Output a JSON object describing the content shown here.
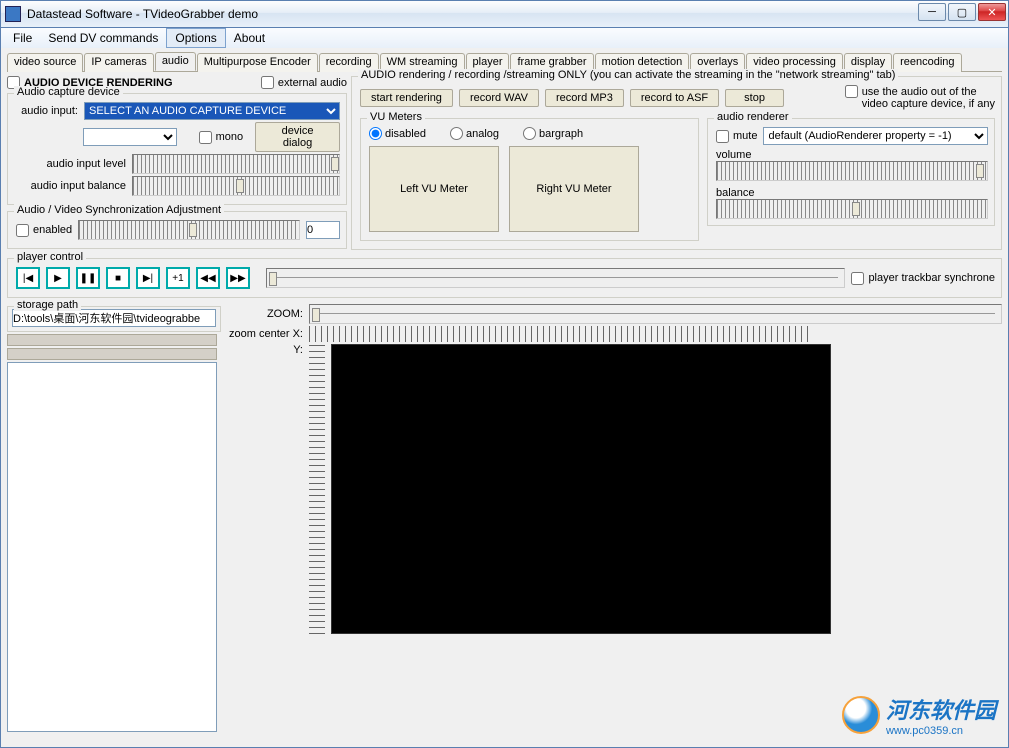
{
  "window": {
    "title": "Datastead Software - TVideoGrabber demo"
  },
  "menu": {
    "file": "File",
    "senddv": "Send DV commands",
    "options": "Options",
    "about": "About"
  },
  "tabs": [
    "video source",
    "IP cameras",
    "audio",
    "Multipurpose Encoder",
    "recording",
    "WM streaming",
    "player",
    "frame grabber",
    "motion detection",
    "overlays",
    "video processing",
    "display",
    "reencoding"
  ],
  "tabs_active_index": 2,
  "audio_render_cb": "AUDIO DEVICE RENDERING",
  "ext_audio": "external audio",
  "capture": {
    "legend": "Audio capture device",
    "audio_input_lbl": "audio input:",
    "select_text": "SELECT AN AUDIO CAPTURE DEVICE",
    "mono": "mono",
    "device_dialog": "device dialog",
    "level": "audio input level",
    "balance": "audio input balance"
  },
  "sync": {
    "legend": "Audio / Video Synchronization Adjustment",
    "enabled": "enabled",
    "value": "0"
  },
  "audiorec": {
    "legend": "AUDIO rendering / recording /streaming ONLY  (you can activate the streaming in the \"network streaming\" tab)",
    "start": "start rendering",
    "wav": "record WAV",
    "mp3": "record MP3",
    "asf": "record to ASF",
    "stop": "stop",
    "useout1": "use the audio out of the",
    "useout2": "video capture device, if any"
  },
  "vu": {
    "legend": "VU Meters",
    "disabled": "disabled",
    "analog": "analog",
    "bargraph": "bargraph",
    "left": "Left VU Meter",
    "right": "Right VU Meter"
  },
  "renderer": {
    "legend": "audio renderer",
    "mute": "mute",
    "default": "default (AudioRenderer property = -1)",
    "volume": "volume",
    "balance": "balance"
  },
  "player": {
    "legend": "player control",
    "sync": "player trackbar synchrone"
  },
  "storage": {
    "legend": "storage path",
    "path": "D:\\tools\\桌面\\河东软件园\\tvideograbbe"
  },
  "zoom": {
    "label": "ZOOM:",
    "cx": "zoom center X:",
    "cy": "Y:"
  },
  "watermark": {
    "name": "河东软件园",
    "url": "www.pc0359.cn"
  }
}
